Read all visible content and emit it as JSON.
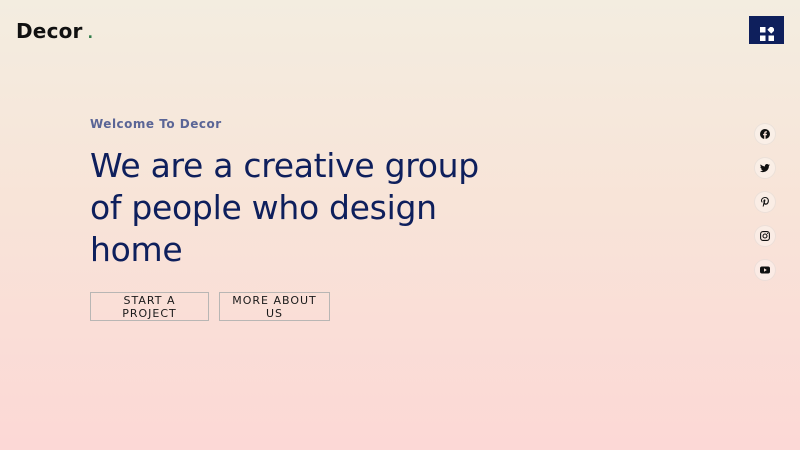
{
  "header": {
    "logo_text": "Decor",
    "logo_dot": ".",
    "menu_icon": "grid-menu-icon"
  },
  "hero": {
    "eyebrow": "Welcome To Decor",
    "headline": "We are a creative group of people who design home",
    "buttons": {
      "start_project": "START A PROJECT",
      "more_about": "MORE ABOUT US"
    }
  },
  "social": {
    "icons": [
      "facebook-icon",
      "twitter-icon",
      "pinterest-icon",
      "instagram-icon",
      "youtube-icon"
    ]
  },
  "colors": {
    "brand_navy": "#0e1f5c",
    "eyebrow": "#5a6596",
    "gradient_top": "#f3ede0",
    "gradient_bottom": "#fcd8d6",
    "logo_dot": "#2f7d4a"
  }
}
